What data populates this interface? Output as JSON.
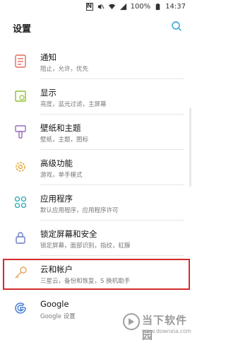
{
  "status_bar": {
    "battery_percent": "100%",
    "time": "14:37"
  },
  "header": {
    "title": "设置"
  },
  "settings_items": [
    {
      "title": "通知",
      "subtitle": "阻止，允许，优先",
      "icon": "notification-icon"
    },
    {
      "title": "显示",
      "subtitle": "亮度，蓝光过滤，主屏幕",
      "icon": "display-icon"
    },
    {
      "title": "壁纸和主题",
      "subtitle": "壁纸，主题，图标",
      "icon": "wallpaper-brush-icon"
    },
    {
      "title": "高级功能",
      "subtitle": "游戏，单手模式",
      "icon": "advanced-gear-icon"
    },
    {
      "title": "应用程序",
      "subtitle": "默认应用程序，应用程序许可",
      "icon": "apps-grid-icon"
    },
    {
      "title": "锁定屏幕和安全",
      "subtitle": "锁定屏幕，面部识别，指纹，虹膜",
      "icon": "lock-icon"
    },
    {
      "title": "云和帐户",
      "subtitle": "三星云，备份和恢复，S 换机助手",
      "icon": "key-icon"
    },
    {
      "title": "Google",
      "subtitle": "Google 设置",
      "icon": "google-icon"
    }
  ],
  "colors": {
    "highlight_border": "#d42b2b",
    "accent": "#2a9fd0"
  },
  "watermark": {
    "brand": "当下软件园",
    "url": "www.downxia.com"
  }
}
